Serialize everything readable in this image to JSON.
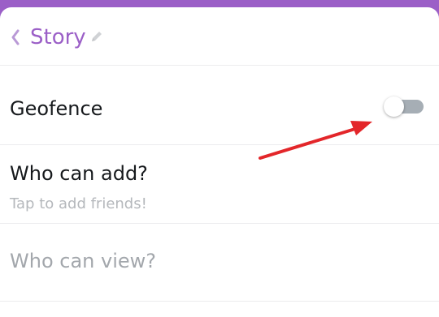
{
  "header": {
    "title": "Story",
    "back_icon": "chevron-left-icon",
    "edit_icon": "pencil-icon"
  },
  "rows": {
    "geofence": {
      "label": "Geofence",
      "toggle_on": false
    },
    "who_can_add": {
      "label": "Who can add?",
      "subtitle": "Tap to add friends!"
    },
    "who_can_view": {
      "label": "Who can view?"
    }
  },
  "colors": {
    "accent": "#9b5fc7",
    "annotation_arrow": "#e3262a",
    "toggle_track_off": "#a6aeb5"
  }
}
